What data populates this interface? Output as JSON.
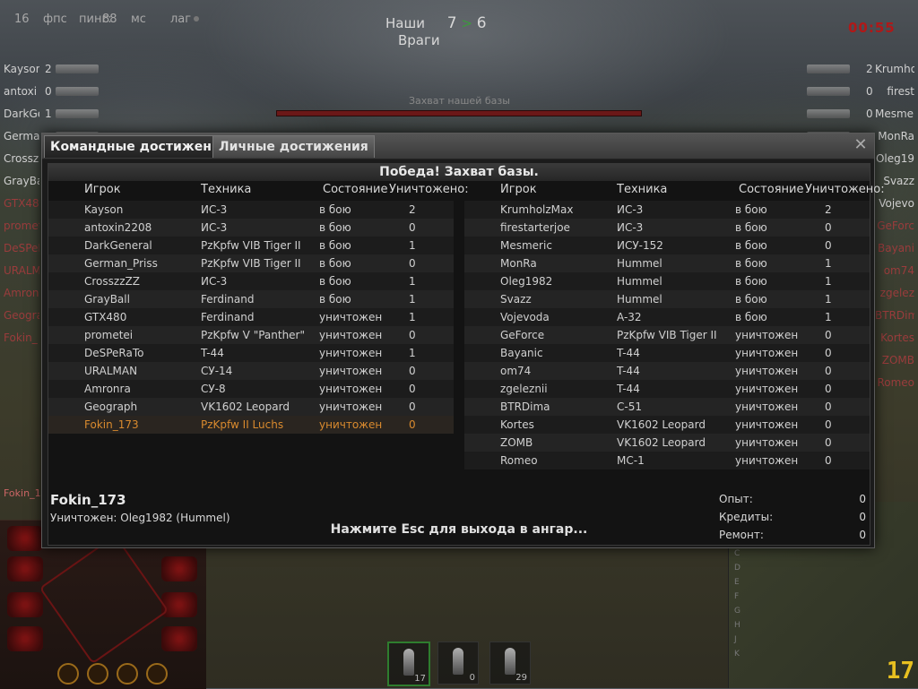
{
  "hud": {
    "fps_value": "16",
    "fps_label": "фпс",
    "ping_label": "пинг:",
    "ping_value": "88",
    "ms_label": "мс",
    "lag_label": "лаг",
    "allies_label": "Наши",
    "allies_score": "7",
    "score_sep": ">",
    "enemies_score": "6",
    "enemies_label": "Враги",
    "timer": "00:55",
    "capture_text": "Захват нашей базы"
  },
  "side_left": [
    {
      "name": "Kayson",
      "kills": "2",
      "alive": true
    },
    {
      "name": "antoxi",
      "kills": "0",
      "alive": true
    },
    {
      "name": "DarkGe",
      "kills": "1",
      "alive": true
    },
    {
      "name": "German",
      "kills": "",
      "alive": true
    },
    {
      "name": "Crossz",
      "kills": "",
      "alive": true
    },
    {
      "name": "GrayBa",
      "kills": "",
      "alive": true
    },
    {
      "name": "GTX480",
      "kills": "",
      "alive": false
    },
    {
      "name": "promet",
      "kills": "",
      "alive": false
    },
    {
      "name": "DeSPeR",
      "kills": "",
      "alive": false
    },
    {
      "name": "URALMA",
      "kills": "",
      "alive": false
    },
    {
      "name": "Amronr",
      "kills": "",
      "alive": false
    },
    {
      "name": "Geogra",
      "kills": "",
      "alive": false
    },
    {
      "name": "Fokin_",
      "kills": "",
      "alive": false
    }
  ],
  "side_right": [
    {
      "name": "Krumho",
      "kills": "2",
      "alive": true
    },
    {
      "name": "firest",
      "kills": "0",
      "alive": true
    },
    {
      "name": "Mesmer",
      "kills": "0",
      "alive": true
    },
    {
      "name": "MonRa",
      "kills": "",
      "alive": true
    },
    {
      "name": "Oleg19",
      "kills": "",
      "alive": true
    },
    {
      "name": "Svazz",
      "kills": "",
      "alive": true
    },
    {
      "name": "Vojevo",
      "kills": "",
      "alive": true
    },
    {
      "name": "GeForc",
      "kills": "",
      "alive": false
    },
    {
      "name": "Bayani",
      "kills": "",
      "alive": false
    },
    {
      "name": "om74",
      "kills": "",
      "alive": false
    },
    {
      "name": "zgelez",
      "kills": "",
      "alive": false
    },
    {
      "name": "BTRDim",
      "kills": "",
      "alive": false
    },
    {
      "name": "Kortes",
      "kills": "",
      "alive": false
    },
    {
      "name": "ZOMB",
      "kills": "",
      "alive": false
    },
    {
      "name": "Romeo",
      "kills": "",
      "alive": false
    }
  ],
  "player_panel_name": "Fokin_17",
  "ammo": [
    {
      "count": "17",
      "selected": true
    },
    {
      "count": "0",
      "selected": false
    },
    {
      "count": "29",
      "selected": false
    }
  ],
  "minimap_letters": [
    "C",
    "D",
    "E",
    "F",
    "G",
    "H",
    "J",
    "K"
  ],
  "logo": "17",
  "dialog": {
    "tab_team": "Командные достижения",
    "tab_personal": "Личные достижения",
    "close": "✕",
    "result": "Победа! Захват базы.",
    "headers": {
      "player": "Игрок",
      "vehicle": "Техника",
      "state": "Состояние",
      "destroyed": "Уничтожено:"
    },
    "team_allies": [
      {
        "player": "Kayson",
        "vehicle": "ИС-3",
        "state": "в бою",
        "destroyed": "2"
      },
      {
        "player": "antoxin2208",
        "vehicle": "ИС-3",
        "state": "в бою",
        "destroyed": "0"
      },
      {
        "player": "DarkGeneral",
        "vehicle": "PzKpfw VIB Tiger II",
        "state": "в бою",
        "destroyed": "1"
      },
      {
        "player": "German_Priss",
        "vehicle": "PzKpfw VIB Tiger II",
        "state": "в бою",
        "destroyed": "0"
      },
      {
        "player": "CrosszzZZ",
        "vehicle": "ИС-3",
        "state": "в бою",
        "destroyed": "1"
      },
      {
        "player": "GrayBall",
        "vehicle": "Ferdinand",
        "state": "в бою",
        "destroyed": "1"
      },
      {
        "player": "GTX480",
        "vehicle": "Ferdinand",
        "state": "уничтожен",
        "destroyed": "1"
      },
      {
        "player": "prometei",
        "vehicle": "PzKpfw V \"Panther\"",
        "state": "уничтожен",
        "destroyed": "0"
      },
      {
        "player": "DeSPeRaTo",
        "vehicle": "T-44",
        "state": "уничтожен",
        "destroyed": "1"
      },
      {
        "player": "URALMAN",
        "vehicle": "СУ-14",
        "state": "уничтожен",
        "destroyed": "0"
      },
      {
        "player": "Amronra",
        "vehicle": "СУ-8",
        "state": "уничтожен",
        "destroyed": "0"
      },
      {
        "player": "Geograph",
        "vehicle": "VK1602 Leopard",
        "state": "уничтожен",
        "destroyed": "0"
      },
      {
        "player": "Fokin_173",
        "vehicle": "PzKpfw II Luchs",
        "state": "уничтожен",
        "destroyed": "0",
        "me": true
      }
    ],
    "team_enemies": [
      {
        "player": "KrumholzMax",
        "vehicle": "ИС-3",
        "state": "в бою",
        "destroyed": "2"
      },
      {
        "player": "firestarterjoe",
        "vehicle": "ИС-3",
        "state": "в бою",
        "destroyed": "0"
      },
      {
        "player": "Mesmeric",
        "vehicle": "ИСУ-152",
        "state": "в бою",
        "destroyed": "0"
      },
      {
        "player": "MonRa",
        "vehicle": "Hummel",
        "state": "в бою",
        "destroyed": "1"
      },
      {
        "player": "Oleg1982",
        "vehicle": "Hummel",
        "state": "в бою",
        "destroyed": "1"
      },
      {
        "player": "Svazz",
        "vehicle": "Hummel",
        "state": "в бою",
        "destroyed": "1"
      },
      {
        "player": "Vojevoda",
        "vehicle": "A-32",
        "state": "в бою",
        "destroyed": "1"
      },
      {
        "player": "GeForce",
        "vehicle": "PzKpfw VIB Tiger II",
        "state": "уничтожен",
        "destroyed": "0"
      },
      {
        "player": "Bayanic",
        "vehicle": "T-44",
        "state": "уничтожен",
        "destroyed": "0"
      },
      {
        "player": "om74",
        "vehicle": "T-44",
        "state": "уничтожен",
        "destroyed": "0"
      },
      {
        "player": "zgeleznii",
        "vehicle": "T-44",
        "state": "уничтожен",
        "destroyed": "0"
      },
      {
        "player": "BTRDima",
        "vehicle": "C-51",
        "state": "уничтожен",
        "destroyed": "0"
      },
      {
        "player": "Kortes",
        "vehicle": "VK1602 Leopard",
        "state": "уничтожен",
        "destroyed": "0"
      },
      {
        "player": "ZOMB",
        "vehicle": "VK1602 Leopard",
        "state": "уничтожен",
        "destroyed": "0"
      },
      {
        "player": "Romeo",
        "vehicle": "MC-1",
        "state": "уничтожен",
        "destroyed": "0"
      }
    ],
    "player_name": "Fokin_173",
    "killed_by": "Уничтожен: Oleg1982 (Hummel)",
    "esc_hint": "Нажмите Esc для выхода в ангар...",
    "stats": [
      {
        "label": "Опыт:",
        "value": "0"
      },
      {
        "label": "Кредиты:",
        "value": "0"
      },
      {
        "label": "Ремонт:",
        "value": "0"
      }
    ]
  },
  "colors": {
    "me": "#d98a2e",
    "dead": "#9a3c3c",
    "timer": "#b01818",
    "logo": "#e8c020"
  }
}
